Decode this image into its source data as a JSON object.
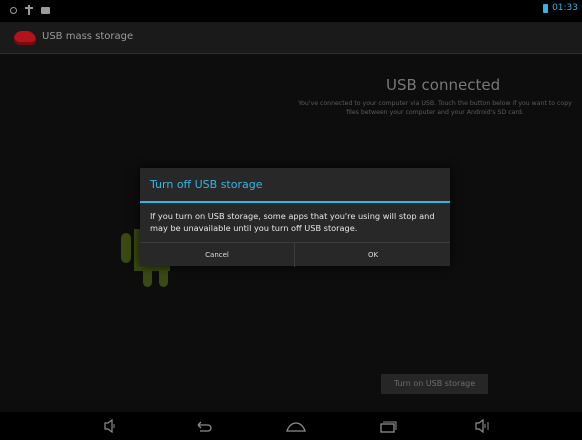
{
  "status_bar": {
    "time": "01:33",
    "icons": [
      "notification-dot-icon",
      "usb-icon",
      "sd-card-icon",
      "battery-icon"
    ],
    "accent_color": "#33b5e5"
  },
  "action_bar": {
    "title": "USB mass storage",
    "icon": "usb-storage-app-icon"
  },
  "main": {
    "heading": "USB connected",
    "description": "You've connected to your computer via USB. Touch the button below if you want to copy files between your computer and your Android's SD card.",
    "turn_on_button": "Turn on USB storage"
  },
  "dialog": {
    "title": "Turn off USB storage",
    "message": "If you turn on USB storage, some apps that you're using will stop and may be unavailable until you turn off USB storage.",
    "cancel_label": "Cancel",
    "ok_label": "OK"
  },
  "nav_bar": {
    "buttons": [
      "volume-down-icon",
      "back-icon",
      "home-icon",
      "recent-apps-icon",
      "volume-up-icon"
    ]
  }
}
